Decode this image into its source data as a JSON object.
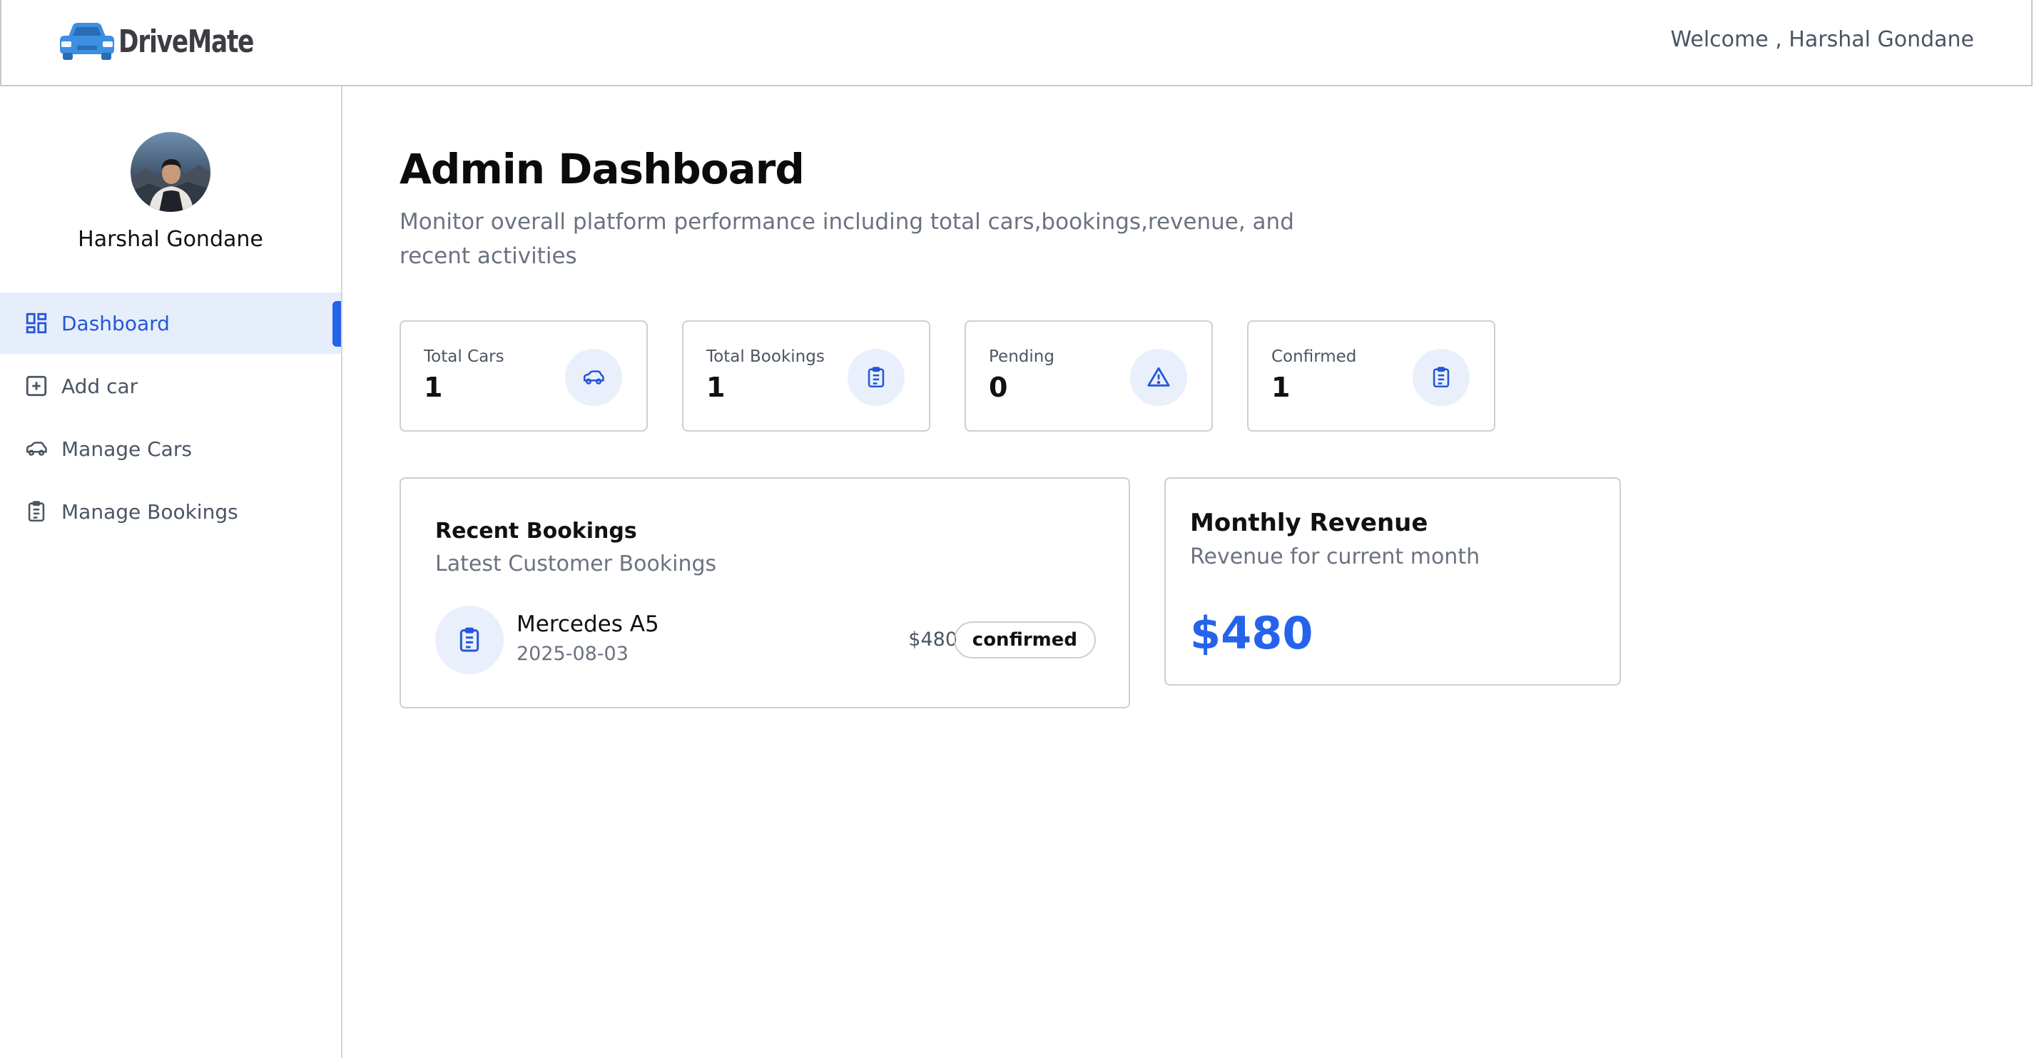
{
  "header": {
    "brand": "DriveMate",
    "welcome": "Welcome , Harshal Gondane"
  },
  "sidebar": {
    "user_name": "Harshal Gondane",
    "items": [
      {
        "label": "Dashboard",
        "icon": "dashboard-icon",
        "active": true
      },
      {
        "label": "Add car",
        "icon": "add-square-icon",
        "active": false
      },
      {
        "label": "Manage Cars",
        "icon": "car-icon",
        "active": false
      },
      {
        "label": "Manage Bookings",
        "icon": "clipboard-list-icon",
        "active": false
      }
    ]
  },
  "main": {
    "title": "Admin Dashboard",
    "subtitle": "Monitor overall platform performance including total cars,bookings,revenue, and recent activities",
    "stats": [
      {
        "label": "Total Cars",
        "value": "1",
        "icon": "car-icon"
      },
      {
        "label": "Total Bookings",
        "value": "1",
        "icon": "clipboard-list-icon"
      },
      {
        "label": "Pending",
        "value": "0",
        "icon": "warning-triangle-icon"
      },
      {
        "label": "Confirmed",
        "value": "1",
        "icon": "clipboard-list-icon"
      }
    ],
    "recent_bookings": {
      "title": "Recent Bookings",
      "subtitle": "Latest Customer Bookings",
      "items": [
        {
          "car": "Mercedes A5",
          "date": "2025-08-03",
          "price": "$480",
          "status": "confirmed"
        }
      ]
    },
    "monthly_revenue": {
      "title": "Monthly Revenue",
      "subtitle": "Revenue for current month",
      "amount": "$480"
    }
  },
  "colors": {
    "accent": "#2563eb",
    "active_bg": "#e6eefc",
    "icon_bg": "#e9effb",
    "muted_text": "#6b7280",
    "border": "#cfcfcf"
  }
}
